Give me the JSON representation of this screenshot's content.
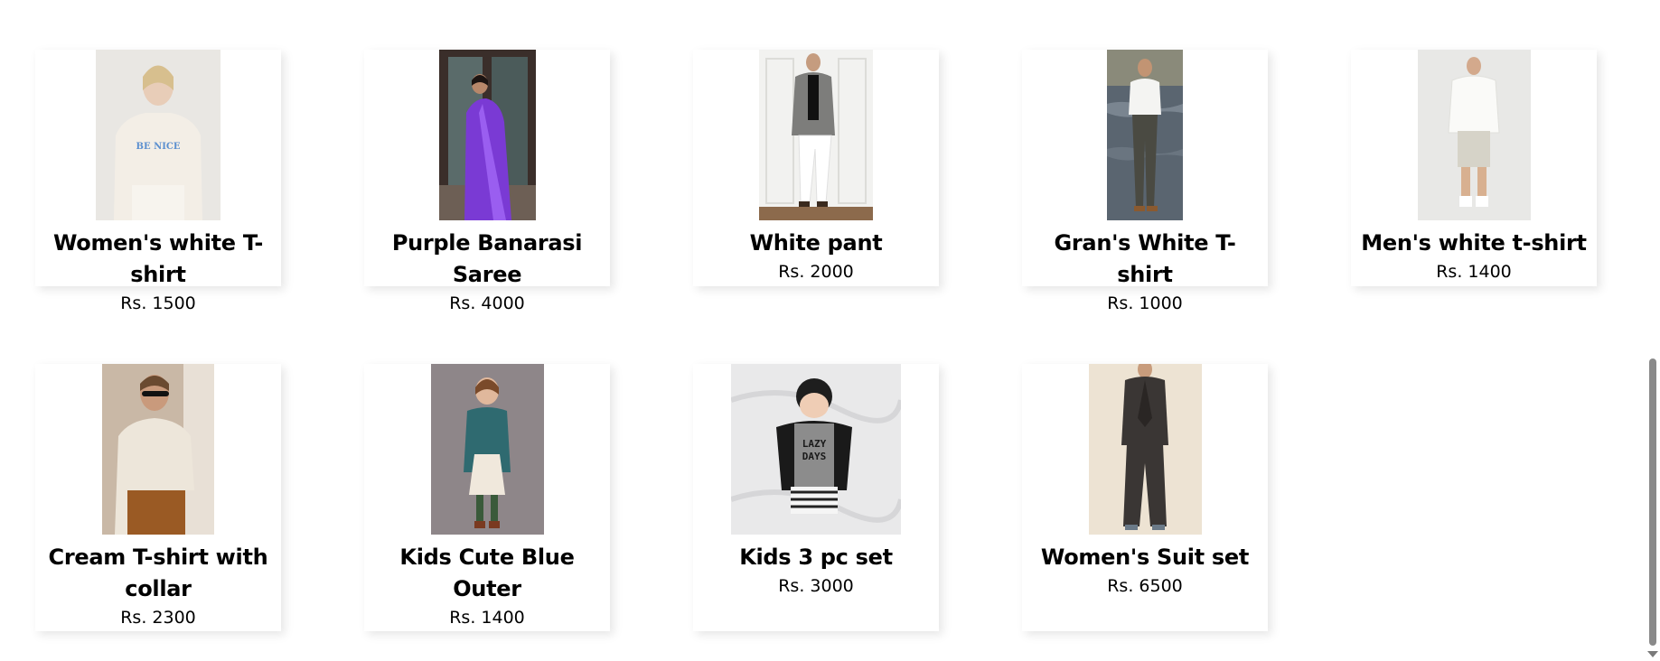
{
  "products": [
    {
      "name": "Women's white T-shirt",
      "price": "Rs. 1500",
      "image": "woman-white-tshirt-photo"
    },
    {
      "name": "Purple Banarasi Saree",
      "price": "Rs. 4000",
      "image": "purple-saree-photo"
    },
    {
      "name": "White pant",
      "price": "Rs. 2000",
      "image": "white-pant-photo"
    },
    {
      "name": "Gran's White T-shirt",
      "price": "Rs. 1000",
      "image": "gran-white-tshirt-photo"
    },
    {
      "name": "Men's white t-shirt",
      "price": "Rs. 1400",
      "image": "men-white-tshirt-photo"
    },
    {
      "name": "Cream T-shirt with collar",
      "price": "Rs. 2300",
      "image": "cream-collar-tshirt-photo"
    },
    {
      "name": "Kids Cute Blue Outer",
      "price": "Rs. 1400",
      "image": "kids-blue-outer-photo"
    },
    {
      "name": "Kids 3 pc set",
      "price": "Rs. 3000",
      "image": "kids-3pc-set-photo",
      "image_text": "LAZY DAYS"
    },
    {
      "name": "Women's Suit set",
      "price": "Rs. 6500",
      "image": "womens-suit-photo"
    }
  ],
  "colors": {
    "background": "#ffffff",
    "text": "#000000",
    "card_shadow": "rgba(0,0,0,0.10)",
    "scrollbar_thumb": "#8a8a8a"
  }
}
